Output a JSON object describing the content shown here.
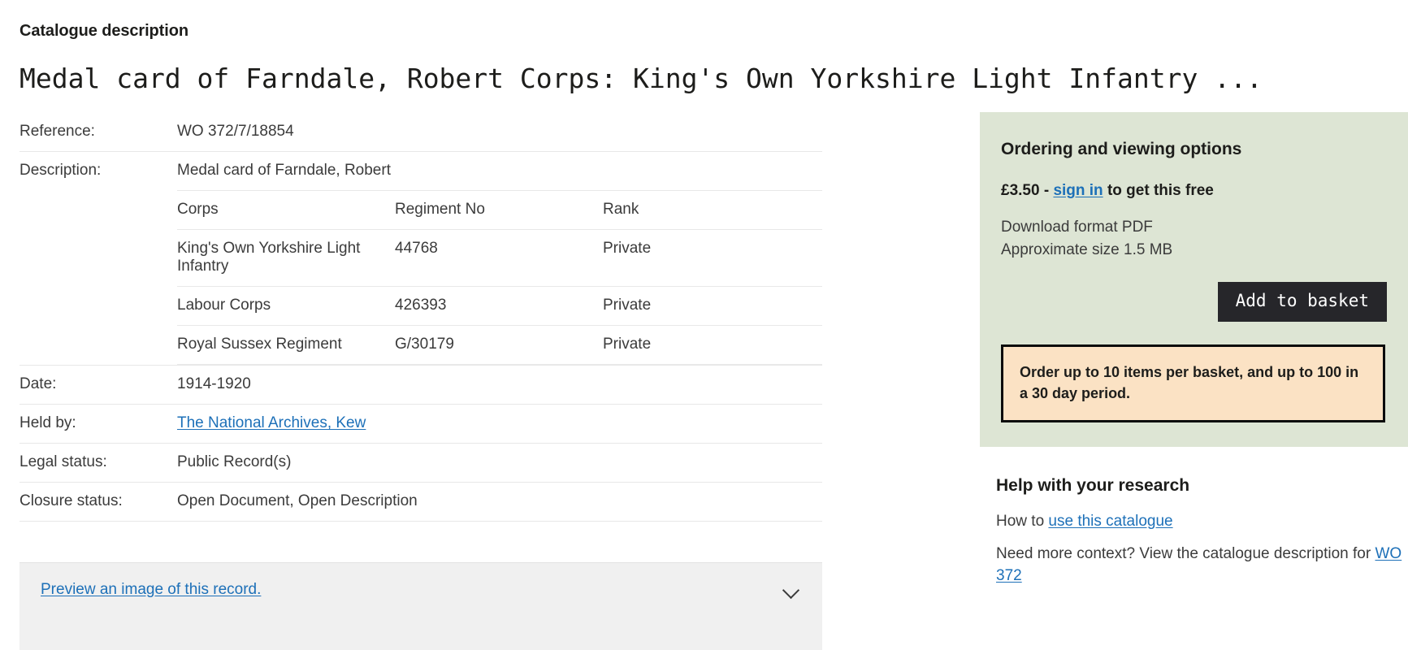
{
  "page": {
    "kicker": "Catalogue description",
    "title": "Medal card of Farndale, Robert Corps: King's Own Yorkshire Light Infantry ..."
  },
  "details": {
    "labels": {
      "reference": "Reference:",
      "description": "Description:",
      "date": "Date:",
      "held_by": "Held by:",
      "legal_status": "Legal status:",
      "closure_status": "Closure status:"
    },
    "values": {
      "reference": "WO 372/7/18854",
      "description_summary": "Medal card of Farndale, Robert",
      "date": "1914-1920",
      "held_by": "The National Archives, Kew",
      "legal_status": "Public Record(s)",
      "closure_status": "Open Document, Open Description"
    }
  },
  "corps_table": {
    "headers": [
      "Corps",
      "Regiment No",
      "Rank"
    ],
    "rows": [
      {
        "corps": "King's Own Yorkshire Light Infantry",
        "regiment_no": "44768",
        "rank": "Private"
      },
      {
        "corps": "Labour Corps",
        "regiment_no": "426393",
        "rank": "Private"
      },
      {
        "corps": "Royal Sussex Regiment",
        "regiment_no": "G/30179",
        "rank": "Private"
      }
    ]
  },
  "accordion": {
    "label": "Preview an image of this record.",
    "icon": "chevron-down-icon"
  },
  "order_panel": {
    "title": "Ordering and viewing options",
    "price_prefix": "£3.50 - ",
    "sign_in_link": "sign in",
    "price_suffix": " to get this free",
    "download_format": "Download format PDF",
    "approx_size": "Approximate size 1.5 MB",
    "add_to_basket": "Add to basket",
    "notice": "Order up to 10 items per basket, and up to 100 in a 30 day period.",
    "background_color": "#dde5d4",
    "notice_background_color": "#fbe2c4",
    "button_color": "#26262a"
  },
  "help": {
    "title": "Help with your research",
    "line1_prefix": "How to ",
    "line1_link": "use this catalogue",
    "line2_prefix": "Need more context? View the catalogue description for ",
    "line2_link": "WO 372"
  },
  "colors": {
    "link": "#1d70b8",
    "text": "#3b3b3b",
    "heading": "#1d1d1b",
    "rule": "#e8e8e8",
    "accordion_bg": "#f0f0f0"
  }
}
